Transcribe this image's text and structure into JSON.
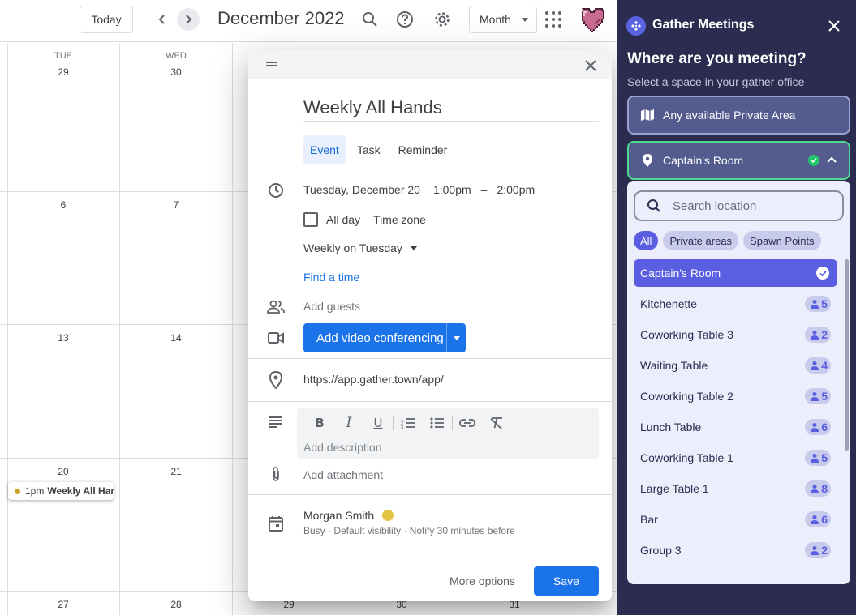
{
  "calendar": {
    "today_label": "Today",
    "title": "December 2022",
    "view": "Month",
    "columns": [
      {
        "dow": "TUE",
        "days": [
          "29",
          "6",
          "13",
          "20",
          "27"
        ]
      },
      {
        "dow": "WED",
        "days": [
          "30",
          "7",
          "14",
          "21",
          "28"
        ]
      }
    ],
    "hidden_days": [
      "29",
      "30",
      "31"
    ],
    "event": {
      "time": "1pm",
      "title": "Weekly All Han"
    }
  },
  "dialog": {
    "title": "Weekly All Hands",
    "tabs": [
      "Event",
      "Task",
      "Reminder"
    ],
    "active_tab": "Event",
    "date": "Tuesday, December 20",
    "start": "1:00pm",
    "dash": "–",
    "end": "2:00pm",
    "all_day": "All day",
    "time_zone": "Time zone",
    "recurrence": "Weekly on Tuesday",
    "find_time": "Find a time",
    "guests_placeholder": "Add guests",
    "video_button": "Add video conferencing",
    "location": "https://app.gather.town/app/",
    "description_placeholder": "Add description",
    "attachment": "Add attachment",
    "owner": "Morgan Smith",
    "owner_details": "Busy · Default visibility · Notify 30 minutes before",
    "more_options": "More options",
    "save": "Save",
    "owner_color": "#e4c441",
    "accent": "#1a73e8"
  },
  "gather": {
    "title": "Gather Meetings",
    "heading": "Where are you meeting?",
    "subheading": "Select a space in your gather office",
    "option_any": "Any available Private Area",
    "option_selected": "Captain's Room",
    "search_placeholder": "Search location",
    "filters": [
      "All",
      "Private areas",
      "Spawn Points"
    ],
    "active_filter": "All",
    "rooms": [
      {
        "name": "Captain's Room",
        "count": null,
        "selected": true
      },
      {
        "name": "Kitchenette",
        "count": "5"
      },
      {
        "name": "Coworking Table 3",
        "count": "2"
      },
      {
        "name": "Waiting Table",
        "count": "4"
      },
      {
        "name": "Coworking Table 2",
        "count": "5"
      },
      {
        "name": "Lunch Table",
        "count": "6"
      },
      {
        "name": "Coworking Table 1",
        "count": "5"
      },
      {
        "name": "Large Table 1",
        "count": "8"
      },
      {
        "name": "Bar",
        "count": "6"
      },
      {
        "name": "Group 3",
        "count": "2"
      }
    ],
    "panel_color": "#2b2c4f",
    "accent": "#5a5ee0",
    "success": "#23c76b"
  }
}
